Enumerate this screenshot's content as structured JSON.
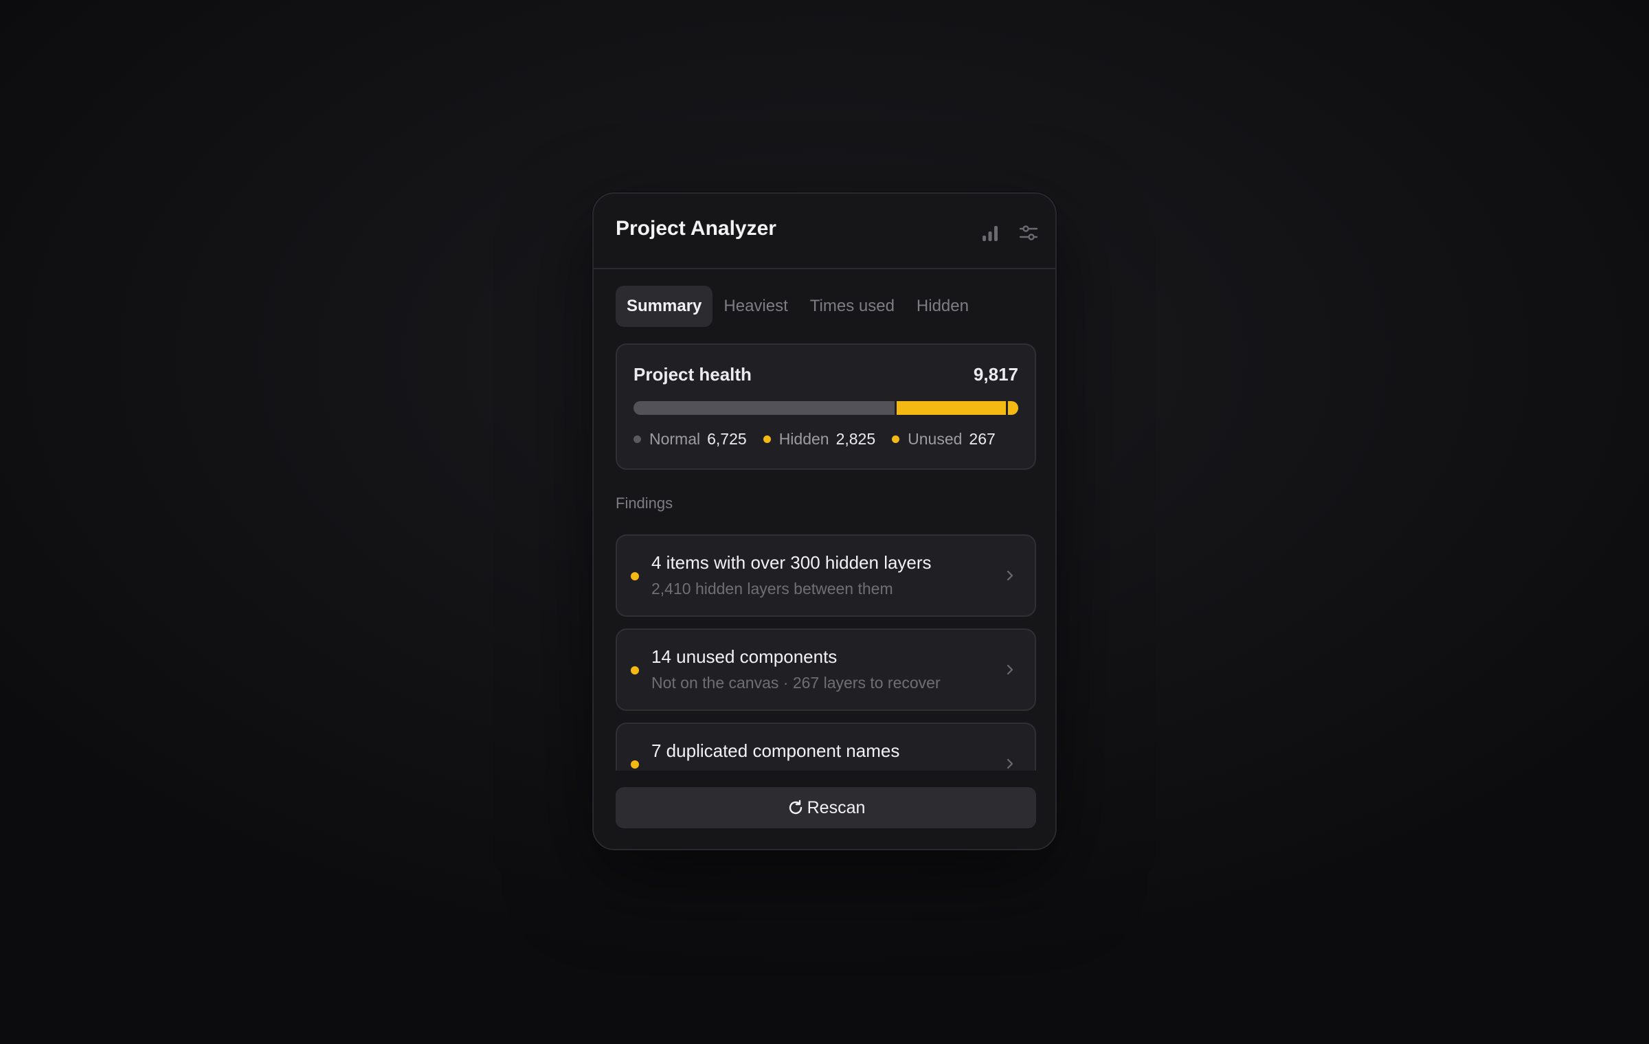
{
  "app": {
    "title": "Project Analyzer"
  },
  "header": {
    "icons": [
      "bar-chart-icon",
      "sliders-icon"
    ]
  },
  "tabs": [
    {
      "label": "Summary",
      "active": true
    },
    {
      "label": "Heaviest",
      "active": false
    },
    {
      "label": "Times used",
      "active": false
    },
    {
      "label": "Hidden",
      "active": false
    }
  ],
  "health": {
    "title": "Project health",
    "total": "9,817",
    "legend": [
      {
        "label": "Normal",
        "value": "6,725",
        "count": 6725,
        "color": "#5a5a60"
      },
      {
        "label": "Hidden",
        "value": "2,825",
        "count": 2825,
        "color": "#f5b914"
      },
      {
        "label": "Unused",
        "value": "267",
        "count": 267,
        "color": "#f5b914"
      }
    ]
  },
  "findings": {
    "label": "Findings",
    "items": [
      {
        "title": "4 items with over 300 hidden layers",
        "subtitle": "2,410 hidden layers between them",
        "dot_color": "#f5b914"
      },
      {
        "title": "14 unused components",
        "subtitle": "Not on the canvas · 267 layers to recover",
        "dot_color": "#f5b914"
      },
      {
        "title": "7 duplicated component names",
        "subtitle": "",
        "dot_color": "#f5b914"
      }
    ]
  },
  "actions": {
    "rescan_label": "Rescan"
  },
  "colors": {
    "accent": "#f5b914",
    "panel": "#161619",
    "card": "#202024"
  }
}
